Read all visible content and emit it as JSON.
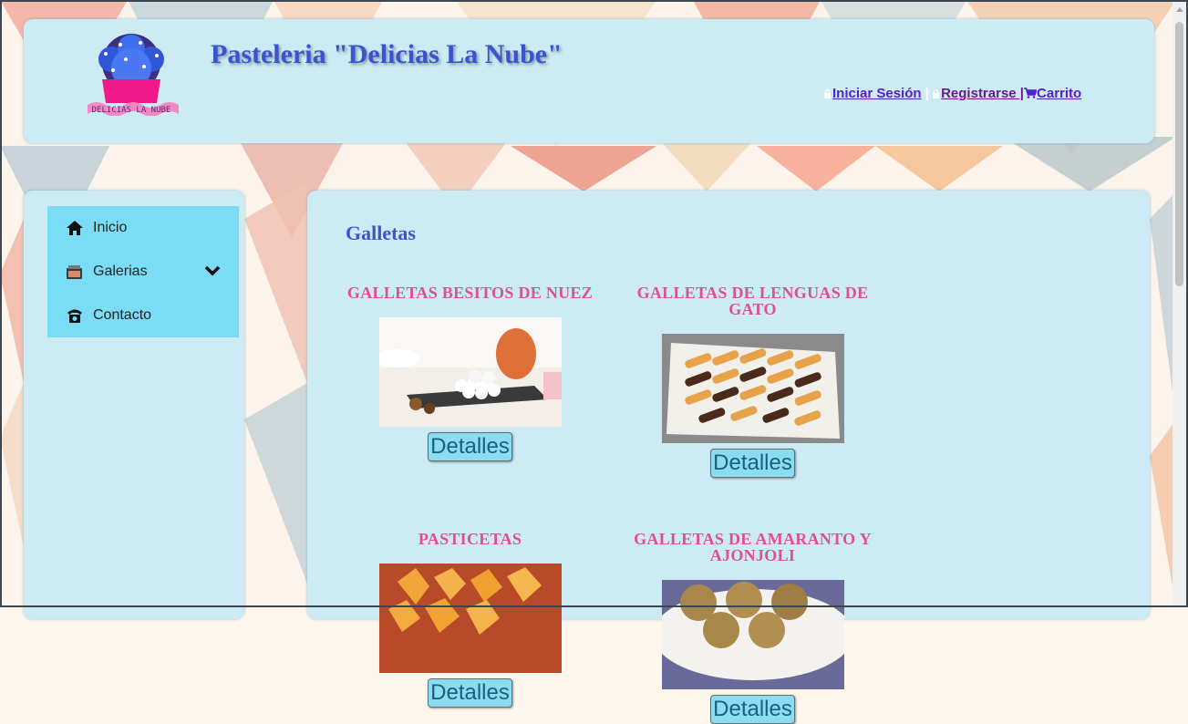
{
  "header": {
    "title": "Pasteleria \"Delicias La Nube\"",
    "logo_text": "DELICIAS LA NUBE",
    "links": {
      "login": "Iniciar Sesión",
      "separator": "|",
      "register": "Registrarse |",
      "cart": "Carrito"
    }
  },
  "sidebar": {
    "items": [
      {
        "label": "Inicio",
        "icon": "home-icon"
      },
      {
        "label": "Galerias",
        "icon": "gallery-icon",
        "has_dropdown": true
      },
      {
        "label": "Contacto",
        "icon": "telephone-icon"
      }
    ]
  },
  "content": {
    "title": "Galletas",
    "products": [
      {
        "name": "GALLETAS BESITOS DE NUEZ",
        "button": "Detalles"
      },
      {
        "name": "GALLETAS DE LENGUAS DE GATO",
        "button": "Detalles"
      },
      {
        "name": "PASTICETAS",
        "button": "Detalles"
      },
      {
        "name": "GALLETAS DE AMARANTO Y AJONJOLI",
        "button": "Detalles"
      }
    ]
  },
  "colors": {
    "panel_bg": "#cdebf5",
    "menu_bg": "#7bdcf5",
    "title_blue": "#3a54d0",
    "product_pink": "#e0508a",
    "link_purple": "#5220d0"
  }
}
